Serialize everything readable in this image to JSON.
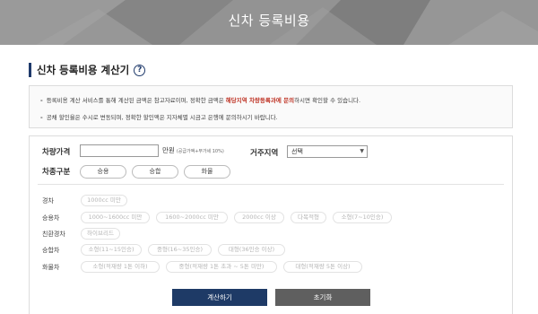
{
  "banner": {
    "title": "신차 등록비용"
  },
  "section": {
    "title": "신차 등록비용 계산기"
  },
  "notices": [
    {
      "prefix": "등록비용 계산 서비스를 통해 계산된 금액은 참고자료이며, 정확한 금액은 ",
      "emphasis": "해당지역 차량등록과에 문의",
      "suffix": "하시면 확인할 수 있습니다."
    },
    {
      "text": "공채 할인율은 수시로 변동되며, 정확한 할인액은 지자체별 시금고 은행에 문의하시기 바랍니다."
    }
  ],
  "form": {
    "price_label": "차량가격",
    "price_value": "",
    "price_unit": "만원",
    "price_note": "(공급가액+부가세 10%)",
    "region_label": "거주지역",
    "region_value": "선택",
    "type_label": "차종구분",
    "types": [
      "승용",
      "승합",
      "화물"
    ]
  },
  "options": {
    "rows": [
      {
        "label": "경차",
        "items": [
          "1000cc 미만"
        ]
      },
      {
        "label": "승용차",
        "items": [
          "1000~1600cc 미만",
          "1600~2000cc 미만",
          "2000cc 이상",
          "다목적형",
          "소형(7~10인승)"
        ]
      },
      {
        "label": "친환경차",
        "items": [
          "하이브리드"
        ]
      },
      {
        "label": "승합차",
        "items": [
          "소형(11~15인승)",
          "중형(16~35인승)",
          "대형(36인승 이상)"
        ]
      },
      {
        "label": "화물차",
        "items": [
          "소형(적재량 1톤 이하)",
          "중형(적재량 1톤 초과 ~ 5톤 미만)",
          "대형(적재량 5톤 이상)"
        ]
      }
    ]
  },
  "buttons": {
    "calculate": "계산하기",
    "reset": "초기화"
  },
  "colors": {
    "primary": "#1e3a66",
    "secondary": "#5f5f5f",
    "emphasis": "#c0392b",
    "banner": "#8c8c8c"
  }
}
